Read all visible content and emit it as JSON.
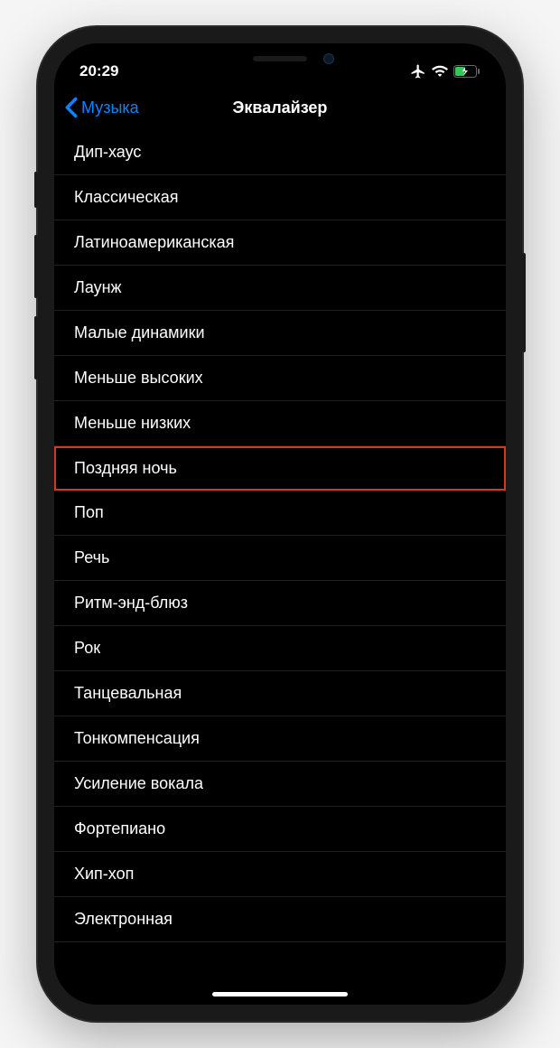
{
  "statusBar": {
    "time": "20:29"
  },
  "navBar": {
    "backLabel": "Музыка",
    "title": "Эквалайзер"
  },
  "equalizerPresets": [
    {
      "label": "Дип-хаус",
      "highlighted": false
    },
    {
      "label": "Классическая",
      "highlighted": false
    },
    {
      "label": "Латиноамериканская",
      "highlighted": false
    },
    {
      "label": "Лаунж",
      "highlighted": false
    },
    {
      "label": "Малые динамики",
      "highlighted": false
    },
    {
      "label": "Меньше высоких",
      "highlighted": false
    },
    {
      "label": "Меньше низких",
      "highlighted": false
    },
    {
      "label": "Поздняя ночь",
      "highlighted": true
    },
    {
      "label": "Поп",
      "highlighted": false
    },
    {
      "label": "Речь",
      "highlighted": false
    },
    {
      "label": "Ритм-энд-блюз",
      "highlighted": false
    },
    {
      "label": "Рок",
      "highlighted": false
    },
    {
      "label": "Танцевальная",
      "highlighted": false
    },
    {
      "label": "Тонкомпенсация",
      "highlighted": false
    },
    {
      "label": "Усиление вокала",
      "highlighted": false
    },
    {
      "label": "Фортепиано",
      "highlighted": false
    },
    {
      "label": "Хип-хоп",
      "highlighted": false
    },
    {
      "label": "Электронная",
      "highlighted": false
    }
  ]
}
